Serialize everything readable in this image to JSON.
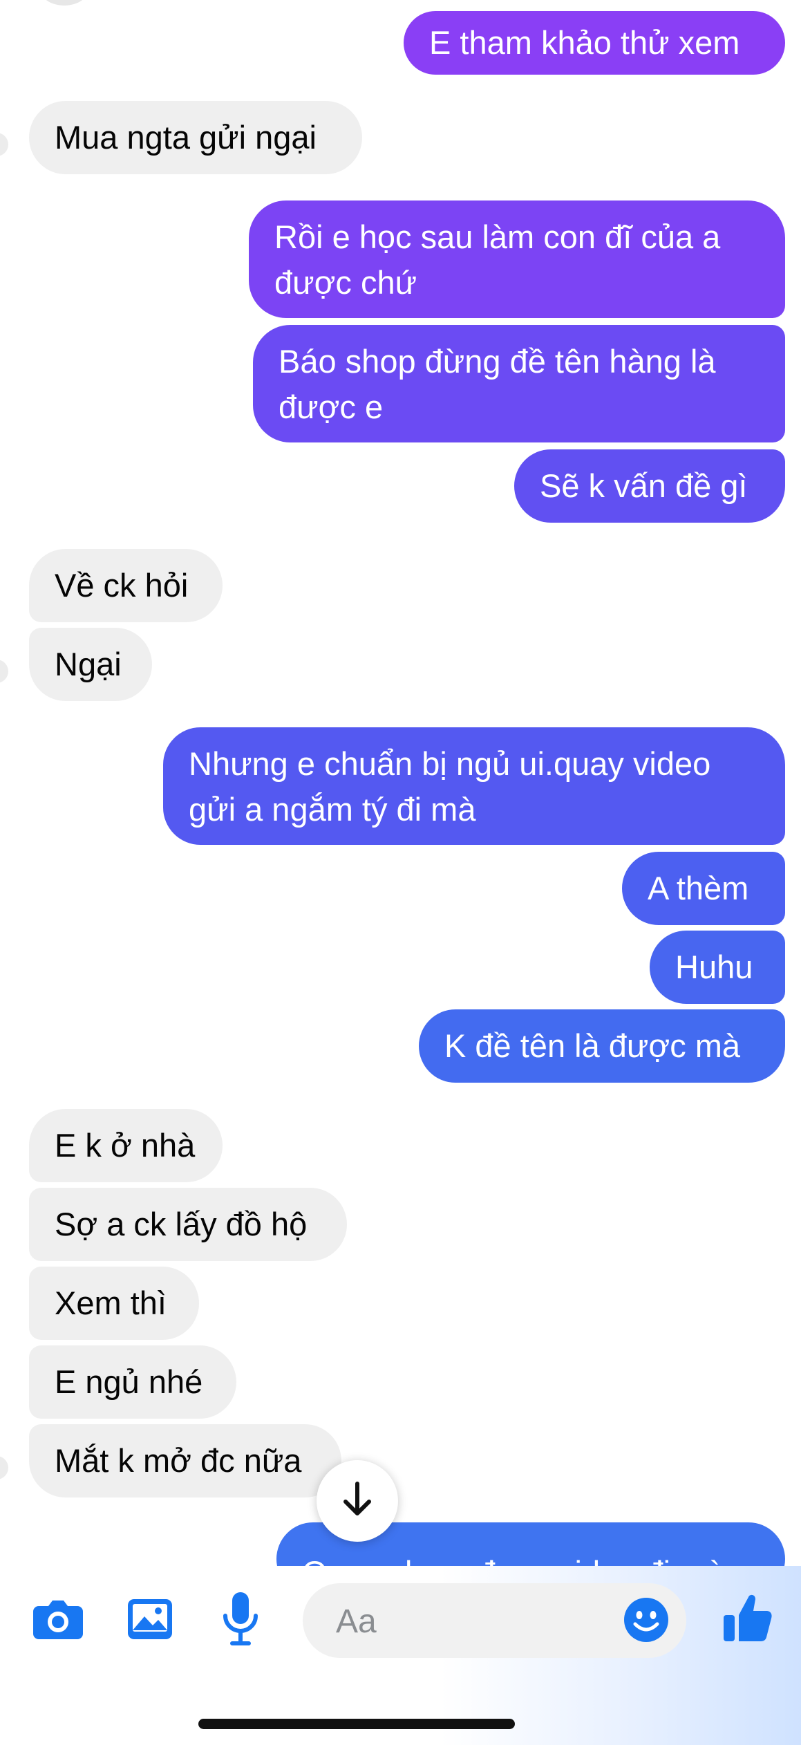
{
  "messages": [
    {
      "side": "out",
      "text": "E tham khảo thử xem"
    },
    {
      "side": "in",
      "text": "Mua ngta gửi ngại"
    },
    {
      "side": "out",
      "text": "Rồi e học sau làm con đĩ của a được chứ"
    },
    {
      "side": "out",
      "text": "Báo shop đừng đề tên hàng là được e"
    },
    {
      "side": "out",
      "text": "Sẽ k vấn đề gì"
    },
    {
      "side": "in",
      "text": "Về ck hỏi"
    },
    {
      "side": "in",
      "text": "Ngại"
    },
    {
      "side": "out",
      "text": "Nhưng e chuẩn bị ngủ ui.quay video gửi a ngắm tý đi mà"
    },
    {
      "side": "out",
      "text": "A thèm"
    },
    {
      "side": "out",
      "text": "Huhu"
    },
    {
      "side": "out",
      "text": "K đề tên là được mà"
    },
    {
      "side": "in",
      "text": "E k ở nhà"
    },
    {
      "side": "in",
      "text": "Sợ a ck lấy đồ hộ"
    },
    {
      "side": "in",
      "text": "Xem thì"
    },
    {
      "side": "in",
      "text": "E ngủ nhé"
    },
    {
      "side": "in",
      "text": "Mắt k mở đc nữa"
    },
    {
      "side": "out",
      "text": "Quay cho a đoạn video đi mà"
    }
  ],
  "composer": {
    "placeholder": "Aa",
    "icons": [
      "camera-icon",
      "image-icon",
      "microphone-icon",
      "emoji-icon",
      "thumbs-up-icon"
    ]
  },
  "scroll_button_icon": "arrow-down-icon",
  "colors": {
    "incoming_bubble": "#efefef",
    "outgoing_top": "#8a3ff5",
    "outgoing_mid": "#5a53f1",
    "outgoing_bottom": "#3f74f0",
    "icon_blue": "#1877f2"
  }
}
